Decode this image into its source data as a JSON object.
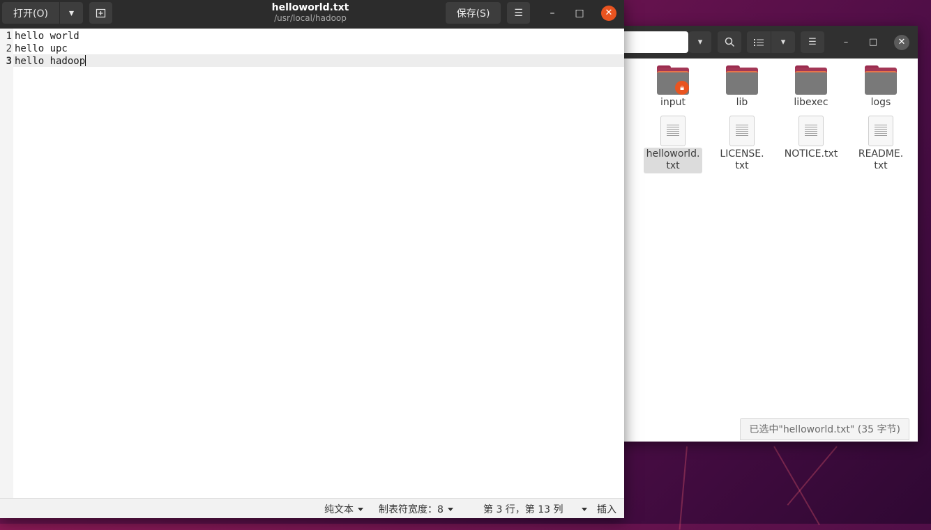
{
  "editor": {
    "title": "helloworld.txt",
    "subtitle": "/usr/local/hadoop",
    "open_button": "打开(O)",
    "save_button": "保存(S)",
    "lines": [
      "hello world",
      "hello upc",
      "hello hadoop"
    ],
    "line_numbers": [
      "1",
      "2",
      "3"
    ],
    "current_line": 3,
    "status": {
      "syntax": "纯文本",
      "tab_width": "制表符宽度：8",
      "position": "第 3 行，第 13 列",
      "mode": "插入"
    }
  },
  "files": {
    "items": [
      {
        "name": "input",
        "type": "folder",
        "locked": true
      },
      {
        "name": "lib",
        "type": "folder"
      },
      {
        "name": "libexec",
        "type": "folder"
      },
      {
        "name": "logs",
        "type": "folder"
      },
      {
        "name_line1": "helloworld.",
        "name_line2": "txt",
        "type": "text",
        "selected": true
      },
      {
        "name_line1": "LICENSE.",
        "name_line2": "txt",
        "type": "text"
      },
      {
        "name_line1": "NOTICE.txt",
        "name_line2": "",
        "type": "text"
      },
      {
        "name_line1": "README.",
        "name_line2": "txt",
        "type": "text"
      }
    ],
    "status": "已选中\"helloworld.txt\" (35 字节)"
  },
  "icons": {
    "new_tab": "new-tab-icon",
    "menu": "hamburger-menu-icon",
    "search": "search-icon",
    "list_view": "list-view-icon",
    "lock": "lock-icon"
  },
  "colors": {
    "accent_close": "#e95420",
    "headerbar": "#2c2c2c",
    "current_line": "#ededed"
  }
}
